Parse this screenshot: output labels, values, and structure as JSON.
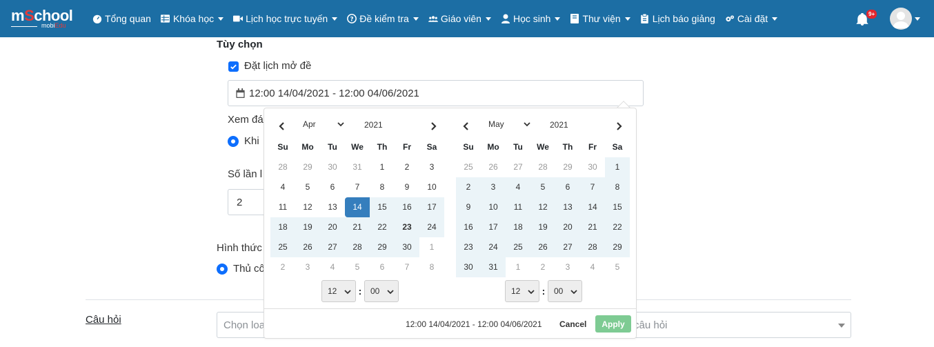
{
  "brand": {
    "logo_main_a": "m",
    "logo_main_s": "S",
    "logo_main_b": "chool",
    "logo_sub_a": "mobi",
    "logo_sub_b": "Edu"
  },
  "nav": [
    {
      "label": "Tổng quan",
      "icon": "dashboard-icon",
      "caret": false
    },
    {
      "label": "Khóa học",
      "icon": "table-icon",
      "caret": true
    },
    {
      "label": "Lịch học trực tuyến",
      "icon": "video-icon",
      "caret": true
    },
    {
      "label": "Đề kiểm tra",
      "icon": "question-circle-icon",
      "caret": true
    },
    {
      "label": "Giáo viên",
      "icon": "users-icon",
      "caret": true
    },
    {
      "label": "Học sinh",
      "icon": "user-icon",
      "caret": true
    },
    {
      "label": "Thư viện",
      "icon": "book-icon",
      "caret": true
    },
    {
      "label": "Lịch báo giảng",
      "icon": "clipboard-icon",
      "caret": false
    },
    {
      "label": "Cài đặt",
      "icon": "cogs-icon",
      "caret": true
    }
  ],
  "notifications": {
    "badge": "9+"
  },
  "form": {
    "options_title": "Tùy chọn",
    "schedule_checkbox_label": "Đặt lịch mở đề",
    "schedule_checked": true,
    "date_range_value": "12:00 14/04/2021 - 12:00 04/06/2021",
    "view_answers_label": "Xem đá",
    "view_answers_option": "Khi",
    "attempts_label": "Số lần l",
    "attempts_value": "2",
    "form_type_label": "Hình thức",
    "form_type_option": "Thủ cô",
    "questions_link": "Câu hỏi",
    "question_type_placeholder": "Chọn loa",
    "question_select_placeholder": "câu hỏi"
  },
  "datepicker": {
    "weekdays": [
      "Su",
      "Mo",
      "Tu",
      "We",
      "Th",
      "Fr",
      "Sa"
    ],
    "left": {
      "month": "Apr",
      "year": "2021",
      "weeks": [
        [
          "28",
          "29",
          "30",
          "31",
          "1",
          "2",
          "3"
        ],
        [
          "4",
          "5",
          "6",
          "7",
          "8",
          "9",
          "10"
        ],
        [
          "11",
          "12",
          "13",
          "14",
          "15",
          "16",
          "17"
        ],
        [
          "18",
          "19",
          "20",
          "21",
          "22",
          "23",
          "24"
        ],
        [
          "25",
          "26",
          "27",
          "28",
          "29",
          "30",
          "1"
        ],
        [
          "2",
          "3",
          "4",
          "5",
          "6",
          "7",
          "8"
        ]
      ]
    },
    "right": {
      "month": "May",
      "year": "2021",
      "weeks": [
        [
          "25",
          "26",
          "27",
          "28",
          "29",
          "30",
          "1"
        ],
        [
          "2",
          "3",
          "4",
          "5",
          "6",
          "7",
          "8"
        ],
        [
          "9",
          "10",
          "11",
          "12",
          "13",
          "14",
          "15"
        ],
        [
          "16",
          "17",
          "18",
          "19",
          "20",
          "21",
          "22"
        ],
        [
          "23",
          "24",
          "25",
          "26",
          "27",
          "28",
          "29"
        ],
        [
          "30",
          "31",
          "1",
          "2",
          "3",
          "4",
          "5"
        ]
      ]
    },
    "start_time": {
      "hour": "12",
      "minute": "00"
    },
    "end_time": {
      "hour": "12",
      "minute": "00"
    },
    "range_text": "12:00 14/04/2021 - 12:00 04/06/2021",
    "cancel_label": "Cancel",
    "apply_label": "Apply"
  },
  "colors": {
    "navbar": "#1c6ea4",
    "accent": "#357ebd",
    "in_range": "#ebf4f8",
    "apply": "#7ecb93"
  }
}
